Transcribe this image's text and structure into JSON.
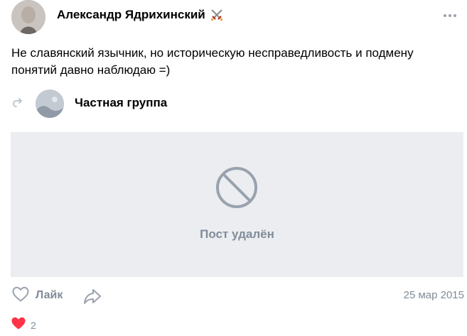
{
  "author": {
    "name": "Александр Ядрихинский",
    "badge_icon": "crossed-swords-icon"
  },
  "post": {
    "text": "Не славянский язычник, но историческую несправедливость и подмену понятий давно наблюдаю =)"
  },
  "repost": {
    "icon": "repost-arrow-icon",
    "group_name": "Частная группа"
  },
  "deleted": {
    "icon": "prohibited-icon",
    "label": "Пост удалён"
  },
  "actions": {
    "like_label": "Лайк",
    "share_icon": "share-icon",
    "date": "25 мар 2015"
  },
  "reactions": {
    "icon": "heart-reaction-icon",
    "count": "2"
  },
  "colors": {
    "muted": "#818c99",
    "deleted_bg": "#ebedf0",
    "icon_gray": "#99a2ad",
    "heart": "#ff3347"
  }
}
